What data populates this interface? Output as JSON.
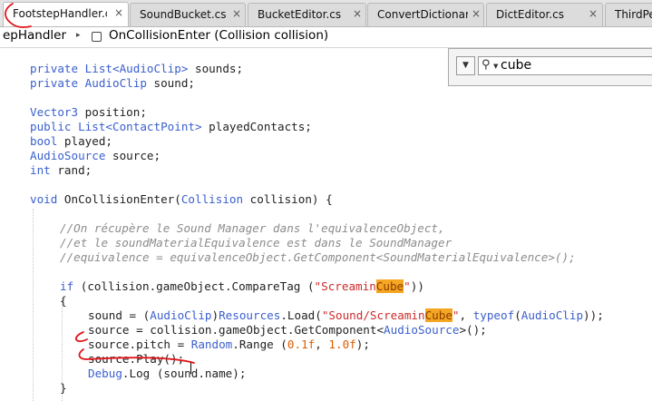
{
  "tabs": [
    {
      "label": "FootstepHandler.cs",
      "active": true
    },
    {
      "label": "SoundBucket.cs",
      "active": false
    },
    {
      "label": "BucketEditor.cs",
      "active": false
    },
    {
      "label": "ConvertDictionary",
      "active": false
    },
    {
      "label": "DictEditor.cs",
      "active": false
    },
    {
      "label": "ThirdPe",
      "active": false
    }
  ],
  "tab_close_glyph": "×",
  "breadcrumb": {
    "class_name": "epHandler",
    "separator": "▸",
    "method": "OnCollisionEnter (Collision collision)"
  },
  "search": {
    "dropdown_glyph": "▼",
    "value": "cube"
  },
  "colors": {
    "keyword": "#3a5fcd",
    "string": "#cc2a2a",
    "number": "#d95d00",
    "comment": "#8c8c8c",
    "search_highlight": "#f5a623",
    "annotation": "#e0161b"
  },
  "code": {
    "l1": {
      "kw": "private",
      "t1": " ",
      "ty": "List<AudioClip>",
      "t2": " sounds;"
    },
    "l2": {
      "kw": "private",
      "t1": " ",
      "ty": "AudioClip",
      "t2": " sound;"
    },
    "l3": {
      "ty": "Vector3",
      "t1": " position;"
    },
    "l4": {
      "kw": "public",
      "t1": " ",
      "ty": "List<ContactPoint>",
      "t2": " playedContacts;"
    },
    "l5": {
      "kw": "bool",
      "t1": " played;"
    },
    "l6": {
      "ty": "AudioSource",
      "t1": " source;"
    },
    "l7": {
      "kw": "int",
      "t1": " rand;"
    },
    "l8": {
      "kw": "void",
      "t1": " OnCollisionEnter(",
      "ty": "Collision",
      "t2": " collision) {"
    },
    "c1": "//On récupère le Sound Manager dans l'equivalenceObject,",
    "c2": "//et le soundMaterialEquivalence est dans le SoundManager",
    "c3": "//equivalence = equivalenceObject.GetComponent<SoundMaterialEquivalence>();",
    "l9": {
      "kw": "if",
      "t1": " (collision.gameObject.CompareTag (",
      "s1": "\"Screamin",
      "h": "Cube",
      "s2": "\"",
      "t2": "))"
    },
    "l10": "{",
    "l11": {
      "t1": "sound = (",
      "ty1": "AudioClip",
      "t2": ")",
      "ty2": "Resources",
      "t3": ".Load(",
      "s1": "\"Sound/Screamin",
      "h": "Cube",
      "s2": "\"",
      "t4": ", ",
      "kw": "typeof",
      "t5": "(",
      "ty3": "AudioClip",
      "t6": "));"
    },
    "l12": {
      "t1": "source = collision.gameObject.GetComponent<",
      "ty": "AudioSource",
      "t2": ">();"
    },
    "l13": {
      "t1": "source.pitch = ",
      "ty": "Random",
      "t2": ".Range (",
      "n1": "0.1f",
      "t3": ", ",
      "n2": "1.0f",
      "t4": ");"
    },
    "l14": "source.Play();",
    "l15": {
      "ty": "Debug",
      "t1": ".Log (sound.name);"
    },
    "l16": "}"
  }
}
